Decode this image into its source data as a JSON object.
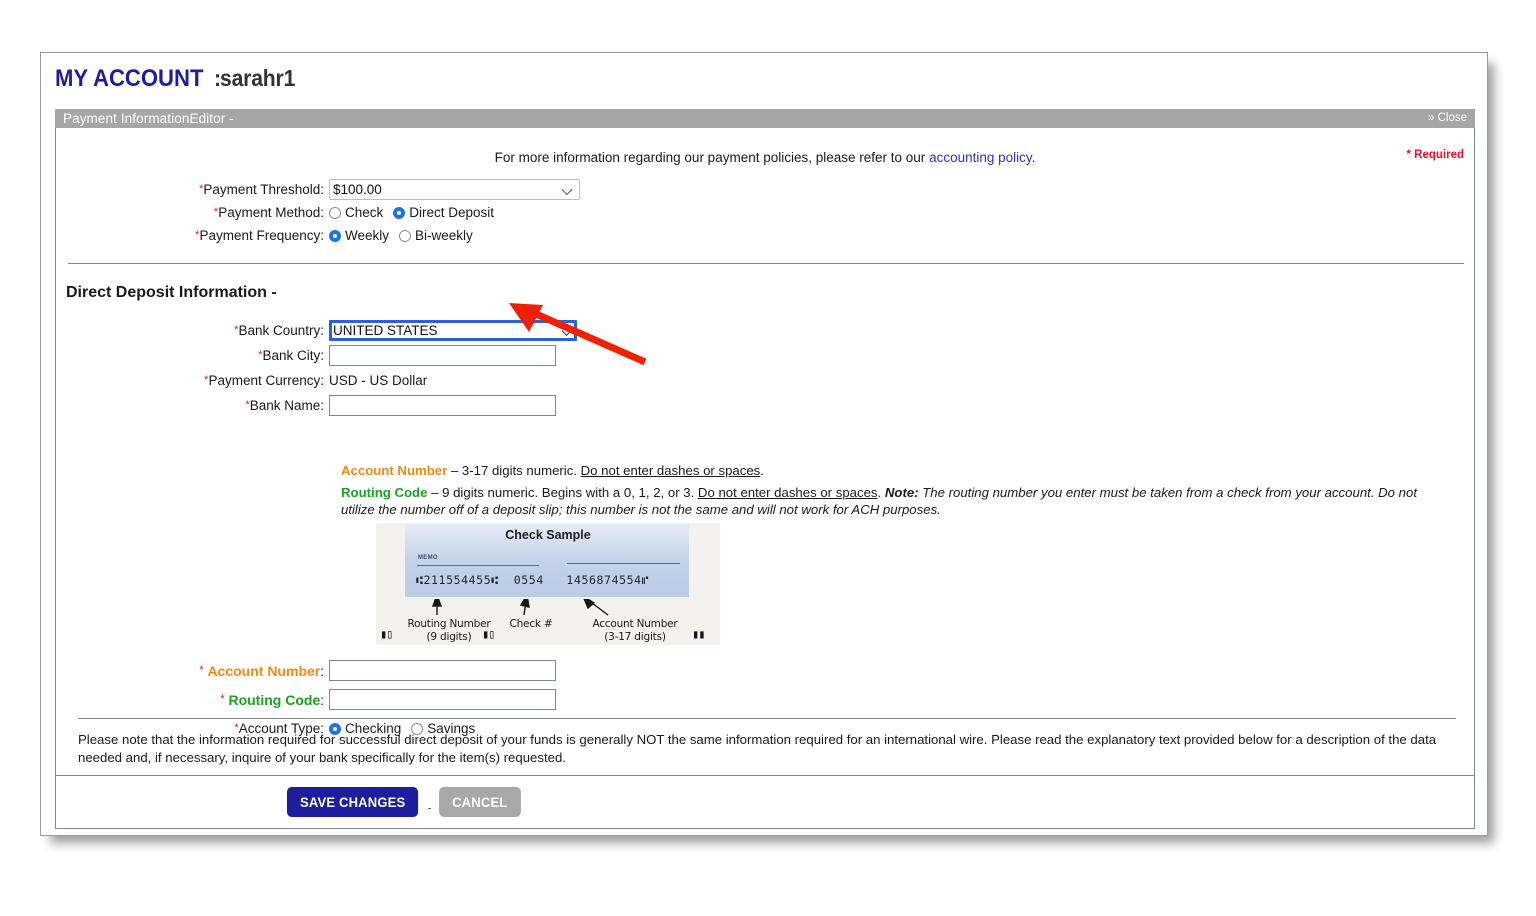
{
  "header": {
    "title_prefix": "MY ACCOUNT",
    "separator": ":",
    "username": "sarahr1"
  },
  "module": {
    "title": "Payment InformationEditor -",
    "close_label": "» Close"
  },
  "top": {
    "info_before": "For more information regarding our payment policies, please refer to our ",
    "info_link": "accounting policy",
    "info_after": ".",
    "required_note": "* Required"
  },
  "payment": {
    "threshold_label": "Payment Threshold:",
    "threshold_value": "$100.00",
    "threshold_options": [
      "$100.00"
    ],
    "method_label": "Payment Method:",
    "method_options": [
      {
        "label": "Check",
        "checked": false
      },
      {
        "label": "Direct Deposit",
        "checked": true
      }
    ],
    "frequency_label": "Payment Frequency:",
    "frequency_options": [
      {
        "label": "Weekly",
        "checked": true
      },
      {
        "label": "Bi-weekly",
        "checked": false
      }
    ]
  },
  "direct_deposit": {
    "section_title": "Direct Deposit Information -",
    "bank_country_label": "Bank Country:",
    "bank_country_value": "UNITED STATES",
    "bank_city_label": "Bank City:",
    "bank_city_value": "",
    "payment_currency_label": "Payment Currency:",
    "payment_currency_value": "USD - US Dollar",
    "bank_name_label": "Bank Name:",
    "bank_name_value": ""
  },
  "helper": {
    "account_number_term": "Account Number",
    "account_number_text_1": " – 3-17 digits numeric. ",
    "account_number_underline": "Do not enter dashes or spaces",
    "account_number_text_2": ".",
    "routing_term": "Routing Code",
    "routing_text_1": " – 9 digits numeric. Begins with a 0, 1, 2, or 3. ",
    "routing_underline": "Do not enter dashes or spaces",
    "routing_text_2": ". ",
    "routing_note_label": "Note:",
    "routing_note_text": " The routing number you enter must be taken from a check from your account. Do not utilize the number off of a deposit slip; this number is not the same and will not work for ACH purposes."
  },
  "check_sample": {
    "title": "Check Sample",
    "memo_label": "MEMO",
    "micr_line": "⑆211554455⑆  0554   1456874554⑈",
    "labels": [
      {
        "line1": "Routing Number",
        "line2": "(9 digits)"
      },
      {
        "line1": "Check #",
        "line2": ""
      },
      {
        "line1": "Account Number",
        "line2": "(3-17 digits)"
      }
    ]
  },
  "account_fields": {
    "account_number_label": "Account Number",
    "account_number_value": "",
    "routing_code_label": "Routing Code",
    "routing_code_value": "",
    "account_type_label": "Account Type:",
    "account_type_options": [
      {
        "label": "Checking",
        "checked": true
      },
      {
        "label": "Savings",
        "checked": false
      }
    ]
  },
  "bottom_note": {
    "text": "Please note that the information required for successful direct deposit of your funds is generally NOT the same information required for an international wire. Please read the explanatory text provided below for a description of the data needed and, if necessary, inquire of your bank specifically for the item(s) requested."
  },
  "buttons": {
    "save_label": "SAVE CHANGES",
    "separator": "-",
    "cancel_label": "CANCEL"
  },
  "colors": {
    "brand_navy": "#1d1d9e",
    "required_red": "#e8112d",
    "account_orange": "#f08a13",
    "routing_green": "#18a320",
    "link_blue": "#3333cc",
    "titlebar_gray": "#a6a6a6",
    "focus_blue": "#2b62d9",
    "annotation_red": "#ee2200"
  }
}
